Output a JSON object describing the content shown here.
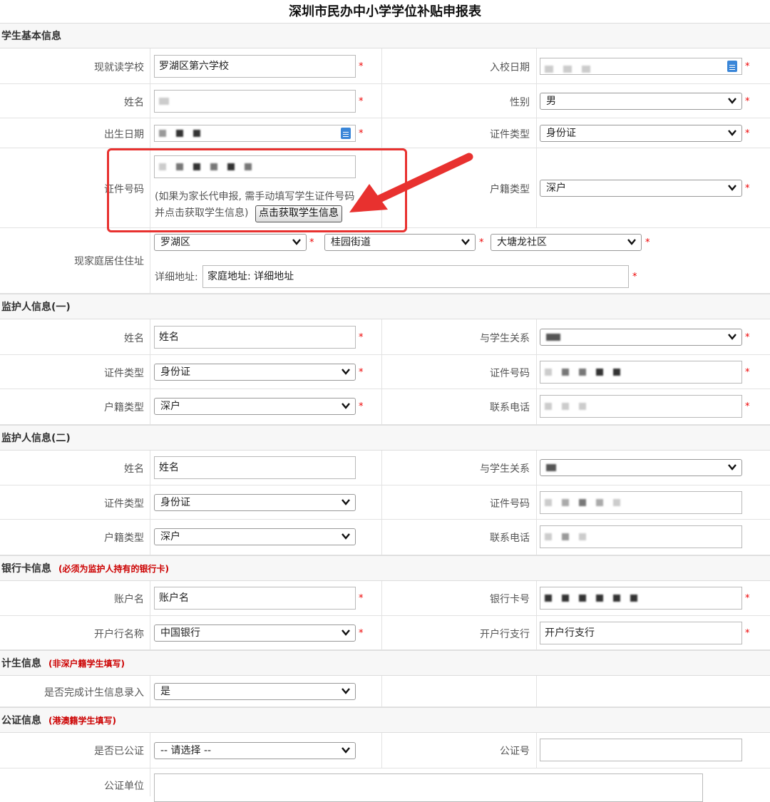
{
  "page": {
    "title": "深圳市民办中小学学位补贴申报表"
  },
  "required_mark": "*",
  "student": {
    "section_title": "学生基本信息",
    "school_label": "现就读学校",
    "school_value": "罗湖区第六学校",
    "enroll_label": "入校日期",
    "name_label": "姓名",
    "gender_label": "性别",
    "gender_value": "男",
    "birth_label": "出生日期",
    "idtype_label": "证件类型",
    "idtype_value": "身份证",
    "idno_label": "证件号码",
    "hint_line1": "(如果为家长代申报, 需手动填写学生证件号码",
    "hint_line2": "并点击获取学生信息)",
    "get_info_button": "点击获取学生信息",
    "hukou_label": "户籍类型",
    "hukou_value": "深户",
    "address_label": "现家庭居住住址",
    "district_value": "罗湖区",
    "street_value": "桂园街道",
    "community_value": "大塘龙社区",
    "detail_label": "详细地址:",
    "detail_value": "家庭地址: 详细地址"
  },
  "guardian1": {
    "section_title": "监护人信息(一)",
    "name_label": "姓名",
    "name_value": "姓名",
    "relation_label": "与学生关系",
    "idtype_label": "证件类型",
    "idtype_value": "身份证",
    "idno_label": "证件号码",
    "hukou_label": "户籍类型",
    "hukou_value": "深户",
    "phone_label": "联系电话"
  },
  "guardian2": {
    "section_title": "监护人信息(二)",
    "name_label": "姓名",
    "name_value": "姓名",
    "relation_label": "与学生关系",
    "idtype_label": "证件类型",
    "idtype_value": "身份证",
    "idno_label": "证件号码",
    "hukou_label": "户籍类型",
    "hukou_value": "深户",
    "phone_label": "联系电话"
  },
  "bank": {
    "section_title": "银行卡信息",
    "note": "(必须为监护人持有的银行卡)",
    "account_label": "账户名",
    "account_value": "账户名",
    "card_label": "银行卡号",
    "bank_label": "开户行名称",
    "bank_value": "中国银行",
    "branch_label": "开户行支行",
    "branch_value": "开户行支行"
  },
  "family_planning": {
    "section_title": "计生信息",
    "note": "(非深户籍学生填写)",
    "done_label": "是否完成计生信息录入",
    "done_value": "是"
  },
  "notary": {
    "section_title": "公证信息",
    "note": "(港澳籍学生填写)",
    "notarized_label": "是否已公证",
    "notarized_value": "-- 请选择 --",
    "number_label": "公证号",
    "unit_label": "公证单位"
  },
  "colors": {
    "required": "#e00000",
    "annotation": "#e8312f",
    "note": "#cc0000"
  },
  "icons": [
    "calendar-icon",
    "chevron-down-icon",
    "arrow-annotation"
  ]
}
